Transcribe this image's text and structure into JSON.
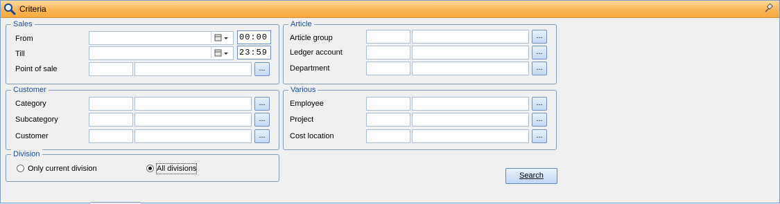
{
  "window": {
    "title": "Criteria",
    "title_icon": "magnifier-icon",
    "pin_icon": "pin-icon"
  },
  "sales": {
    "legend": "Sales",
    "from_label": "From",
    "from_time": "00:00",
    "till_label": "Till",
    "till_time": "23:59",
    "pos_label": "Point of sale",
    "browse_label": "..."
  },
  "customer": {
    "legend": "Customer",
    "category_label": "Category",
    "subcategory_label": "Subcategory",
    "customer_label": "Customer",
    "browse_label": "..."
  },
  "division": {
    "legend": "Division",
    "only_current_label": "Only current division",
    "all_label": "All divisions",
    "selected": "All divisions"
  },
  "article": {
    "legend": "Article",
    "group_label": "Article group",
    "ledger_label": "Ledger account",
    "department_label": "Department",
    "browse_label": "..."
  },
  "various": {
    "legend": "Various",
    "employee_label": "Employee",
    "project_label": "Project",
    "cost_label": "Cost location",
    "browse_label": "..."
  },
  "actions": {
    "search_label": "Search"
  },
  "colors": {
    "title_bar": "#f9b556",
    "legend_text": "#1f4f91",
    "border": "#7f9db9"
  }
}
